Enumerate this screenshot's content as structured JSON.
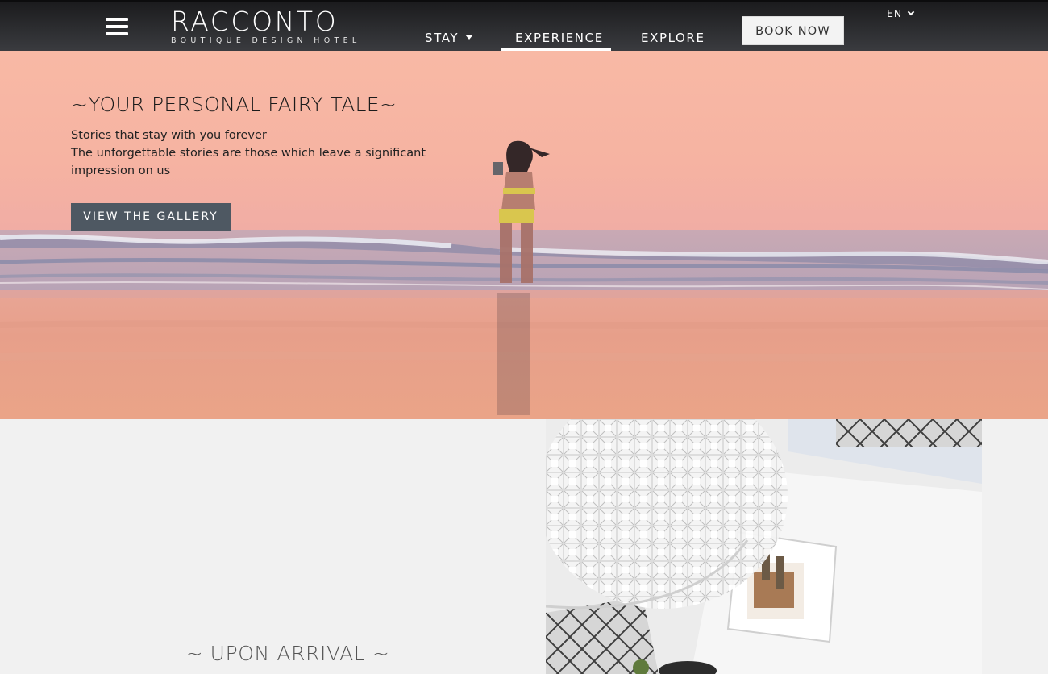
{
  "header": {
    "logo_word": "RACCONTO",
    "logo_tagline": "BOUTIQUE DESIGN HOTEL",
    "nav": {
      "stay": "STAY",
      "experience": "EXPERIENCE",
      "explore": "EXPLORE"
    },
    "active_nav": "EXPERIENCE",
    "book_now": "BOOK NOW",
    "language": "EN"
  },
  "hero": {
    "title": "~YOUR PERSONAL FAIRY TALE~",
    "line1": "Stories that stay with you forever",
    "line2": "The unforgettable stories are those which leave a significant",
    "line3": "impression on us",
    "button": "VIEW THE GALLERY"
  },
  "section": {
    "title": "~ UPON ARRIVAL ~"
  },
  "colors": {
    "header_bg": "#2c2d30",
    "button_bg": "#4e5862",
    "sky_pink": "#f6b3a2",
    "page_bg": "#f1f1f1"
  }
}
